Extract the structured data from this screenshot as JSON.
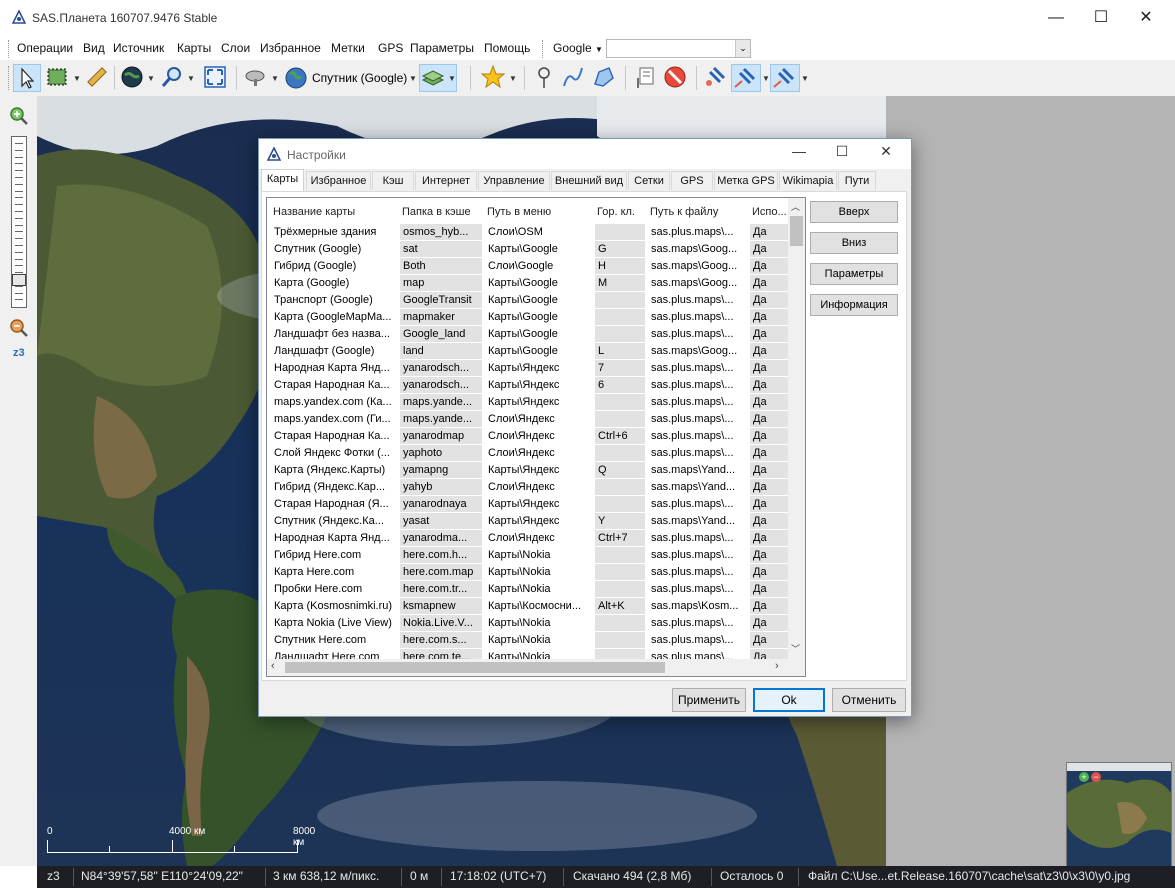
{
  "window": {
    "title": "SAS.Планета 160707.9476 Stable",
    "controls": {
      "minimize": "—",
      "maximize": "☐",
      "close": "✕"
    }
  },
  "menubar": {
    "items": [
      "Операции",
      "Вид",
      "Источник",
      "Карты",
      "Слои",
      "Избранное",
      "Метки",
      "GPS",
      "Параметры",
      "Помощь"
    ],
    "search_provider": "Google",
    "search_value": ""
  },
  "toolbar": {
    "map_source": "Спутник (Google)"
  },
  "zoom": {
    "level": "z3",
    "slider_fraction": 0.13
  },
  "map": {
    "scale_labels": [
      "0",
      "4000 км",
      "8000 км"
    ]
  },
  "statusbar": {
    "zoom": "z3",
    "coords": "N84°39'57,58\" E110°24'09,22\"",
    "resolution": "3 км 638,12 м/пикс.",
    "distance": "0 м",
    "time": "17:18:02 (UTC+7)",
    "downloaded": "Скачано 494 (2,8 Мб)",
    "remaining": "Осталось 0",
    "file": "Файл C:\\Use...et.Release.160707\\cache\\sat\\z3\\0\\x3\\0\\y0.jpg"
  },
  "dialog": {
    "title": "Настройки",
    "tabs": [
      "Карты",
      "Избранное",
      "Кэш",
      "Интернет",
      "Управление",
      "Внешний вид",
      "Сетки",
      "GPS",
      "Метка GPS",
      "Wikimapia",
      "Пути"
    ],
    "active_tab": "Карты",
    "columns": [
      "Название карты",
      "Папка в кэше",
      "Путь в меню",
      "Гор. кл.",
      "Путь к файлу",
      "Испо..."
    ],
    "rows": [
      [
        "Трёхмерные здания",
        "osmos_hyb...",
        "Слои\\OSM",
        "",
        "sas.plus.maps\\...",
        "Да"
      ],
      [
        "Спутник (Google)",
        "sat",
        "Карты\\Google",
        "G",
        "sas.maps\\Goog...",
        "Да"
      ],
      [
        "Гибрид (Google)",
        "Both",
        "Слои\\Google",
        "H",
        "sas.maps\\Goog...",
        "Да"
      ],
      [
        "Карта (Google)",
        "map",
        "Карты\\Google",
        "M",
        "sas.maps\\Goog...",
        "Да"
      ],
      [
        "Транспорт (Google)",
        "GoogleTransit",
        "Карты\\Google",
        "",
        "sas.plus.maps\\...",
        "Да"
      ],
      [
        "Карта (GoogleMapMa...",
        "mapmaker",
        "Карты\\Google",
        "",
        "sas.plus.maps\\...",
        "Да"
      ],
      [
        "Ландшафт без назва...",
        "Google_land",
        "Карты\\Google",
        "",
        "sas.plus.maps\\...",
        "Да"
      ],
      [
        "Ландшафт (Google)",
        "land",
        "Карты\\Google",
        "L",
        "sas.maps\\Goog...",
        "Да"
      ],
      [
        "Народная Карта Янд...",
        "yanarodsch...",
        "Карты\\Яндекс",
        "7",
        "sas.plus.maps\\...",
        "Да"
      ],
      [
        "Старая Народная Ка...",
        "yanarodsch...",
        "Карты\\Яндекс",
        "6",
        "sas.plus.maps\\...",
        "Да"
      ],
      [
        "maps.yandex.com (Ка...",
        "maps.yande...",
        "Карты\\Яндекс",
        "",
        "sas.plus.maps\\...",
        "Да"
      ],
      [
        "maps.yandex.com (Ги...",
        "maps.yande...",
        "Слои\\Яндекс",
        "",
        "sas.plus.maps\\...",
        "Да"
      ],
      [
        "Старая Народная Ка...",
        "yanarodmap",
        "Слои\\Яндекс",
        "Ctrl+6",
        "sas.plus.maps\\...",
        "Да"
      ],
      [
        "Слой Яндекс Фотки (...",
        "yaphoto",
        "Слои\\Яндекс",
        "",
        "sas.plus.maps\\...",
        "Да"
      ],
      [
        "Карта (Яндекс.Карты)",
        "yamapng",
        "Карты\\Яндекс",
        "Q",
        "sas.maps\\Yand...",
        "Да"
      ],
      [
        "Гибрид (Яндекс.Кар...",
        "yahyb",
        "Слои\\Яндекс",
        "",
        "sas.maps\\Yand...",
        "Да"
      ],
      [
        "Старая Народная (Я...",
        "yanarodnaya",
        "Карты\\Яндекс",
        "",
        "sas.plus.maps\\...",
        "Да"
      ],
      [
        "Спутник (Яндекс.Ка...",
        "yasat",
        "Карты\\Яндекс",
        "Y",
        "sas.maps\\Yand...",
        "Да"
      ],
      [
        "Народная Карта Янд...",
        "yanarodma...",
        "Слои\\Яндекс",
        "Ctrl+7",
        "sas.plus.maps\\...",
        "Да"
      ],
      [
        "Гибрид Here.com",
        "here.com.h...",
        "Карты\\Nokia",
        "",
        "sas.plus.maps\\...",
        "Да"
      ],
      [
        "Карта Here.com",
        "here.com.map",
        "Карты\\Nokia",
        "",
        "sas.plus.maps\\...",
        "Да"
      ],
      [
        "Пробки Here.com",
        "here.com.tr...",
        "Карты\\Nokia",
        "",
        "sas.plus.maps\\...",
        "Да"
      ],
      [
        "Карта (Kosmosnimki.ru)",
        "ksmapnew",
        "Карты\\Космосни...",
        "Alt+K",
        "sas.maps\\Kosm...",
        "Да"
      ],
      [
        "Карта Nokia (Live View)",
        "Nokia.Live.V...",
        "Карты\\Nokia",
        "",
        "sas.plus.maps\\...",
        "Да"
      ],
      [
        "Спутник Here.com",
        "here.com.s...",
        "Карты\\Nokia",
        "",
        "sas.plus.maps\\...",
        "Да"
      ],
      [
        "Ландшафт Here.com",
        "here.com.te...",
        "Карты\\Nokia",
        "",
        "sas.plus.maps\\...",
        "Да"
      ]
    ],
    "side_buttons": [
      "Вверх",
      "Вниз",
      "Параметры",
      "Информация"
    ],
    "bottom_buttons": {
      "apply": "Применить",
      "ok": "Ok",
      "cancel": "Отменить"
    }
  }
}
